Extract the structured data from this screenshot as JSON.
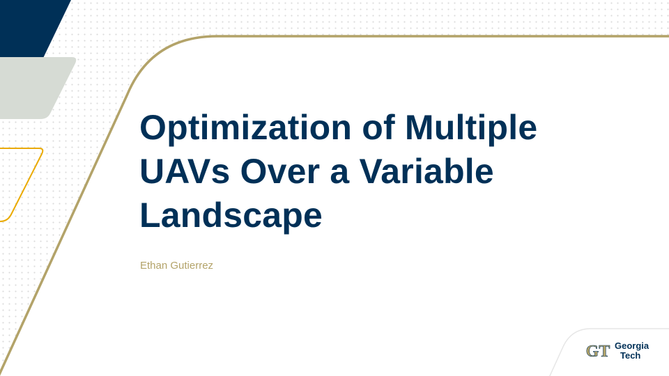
{
  "slide": {
    "title_lines": [
      "Optimization of Multiple",
      "UAVs Over a Variable",
      "Landscape"
    ],
    "author": "Ethan Gutierrez"
  },
  "logo": {
    "line1": "Georgia",
    "line2": "Tech",
    "mark": "GT"
  },
  "colors": {
    "navy": "#003057",
    "gold": "#B3A369",
    "yellow": "#EAAA00",
    "gray": "#D6DBD4",
    "background": "#FFFFFF"
  }
}
